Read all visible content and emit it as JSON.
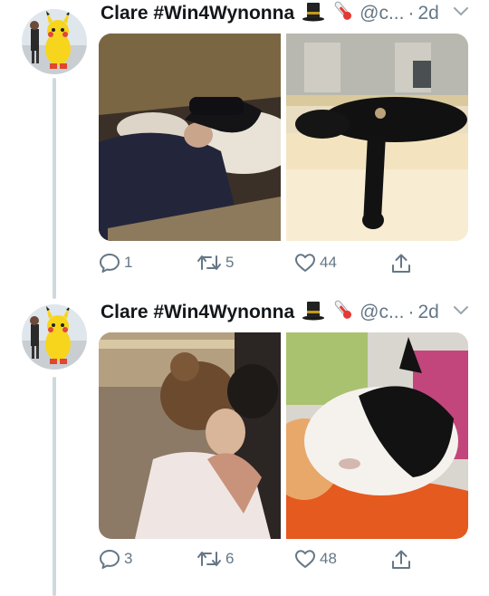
{
  "tweets": [
    {
      "display_name": "Clare #Win4Wynonna",
      "handle": "@c...",
      "separator": "·",
      "time": "2d",
      "replies": "1",
      "retweets": "5",
      "likes": "44",
      "images": [
        "victorian-woman-in-bed-photo",
        "black-cat-on-ledge-photo"
      ]
    },
    {
      "display_name": "Clare #Win4Wynonna",
      "handle": "@c...",
      "separator": "·",
      "time": "2d",
      "replies": "3",
      "retweets": "6",
      "likes": "48",
      "images": [
        "period-drama-kiss-photo",
        "cats-cuddling-photo"
      ]
    }
  ],
  "icons": {
    "top_hat": "top-hat-emoji",
    "thermometer": "thermometer-emoji",
    "menu": "chevron-down-icon",
    "reply": "reply-icon",
    "retweet": "retweet-icon",
    "like": "heart-icon",
    "share": "share-icon"
  },
  "colors": {
    "name": "#14171a",
    "meta": "#657786",
    "thread_line": "#cfd9de",
    "avatar_character": "#f7d51d"
  }
}
